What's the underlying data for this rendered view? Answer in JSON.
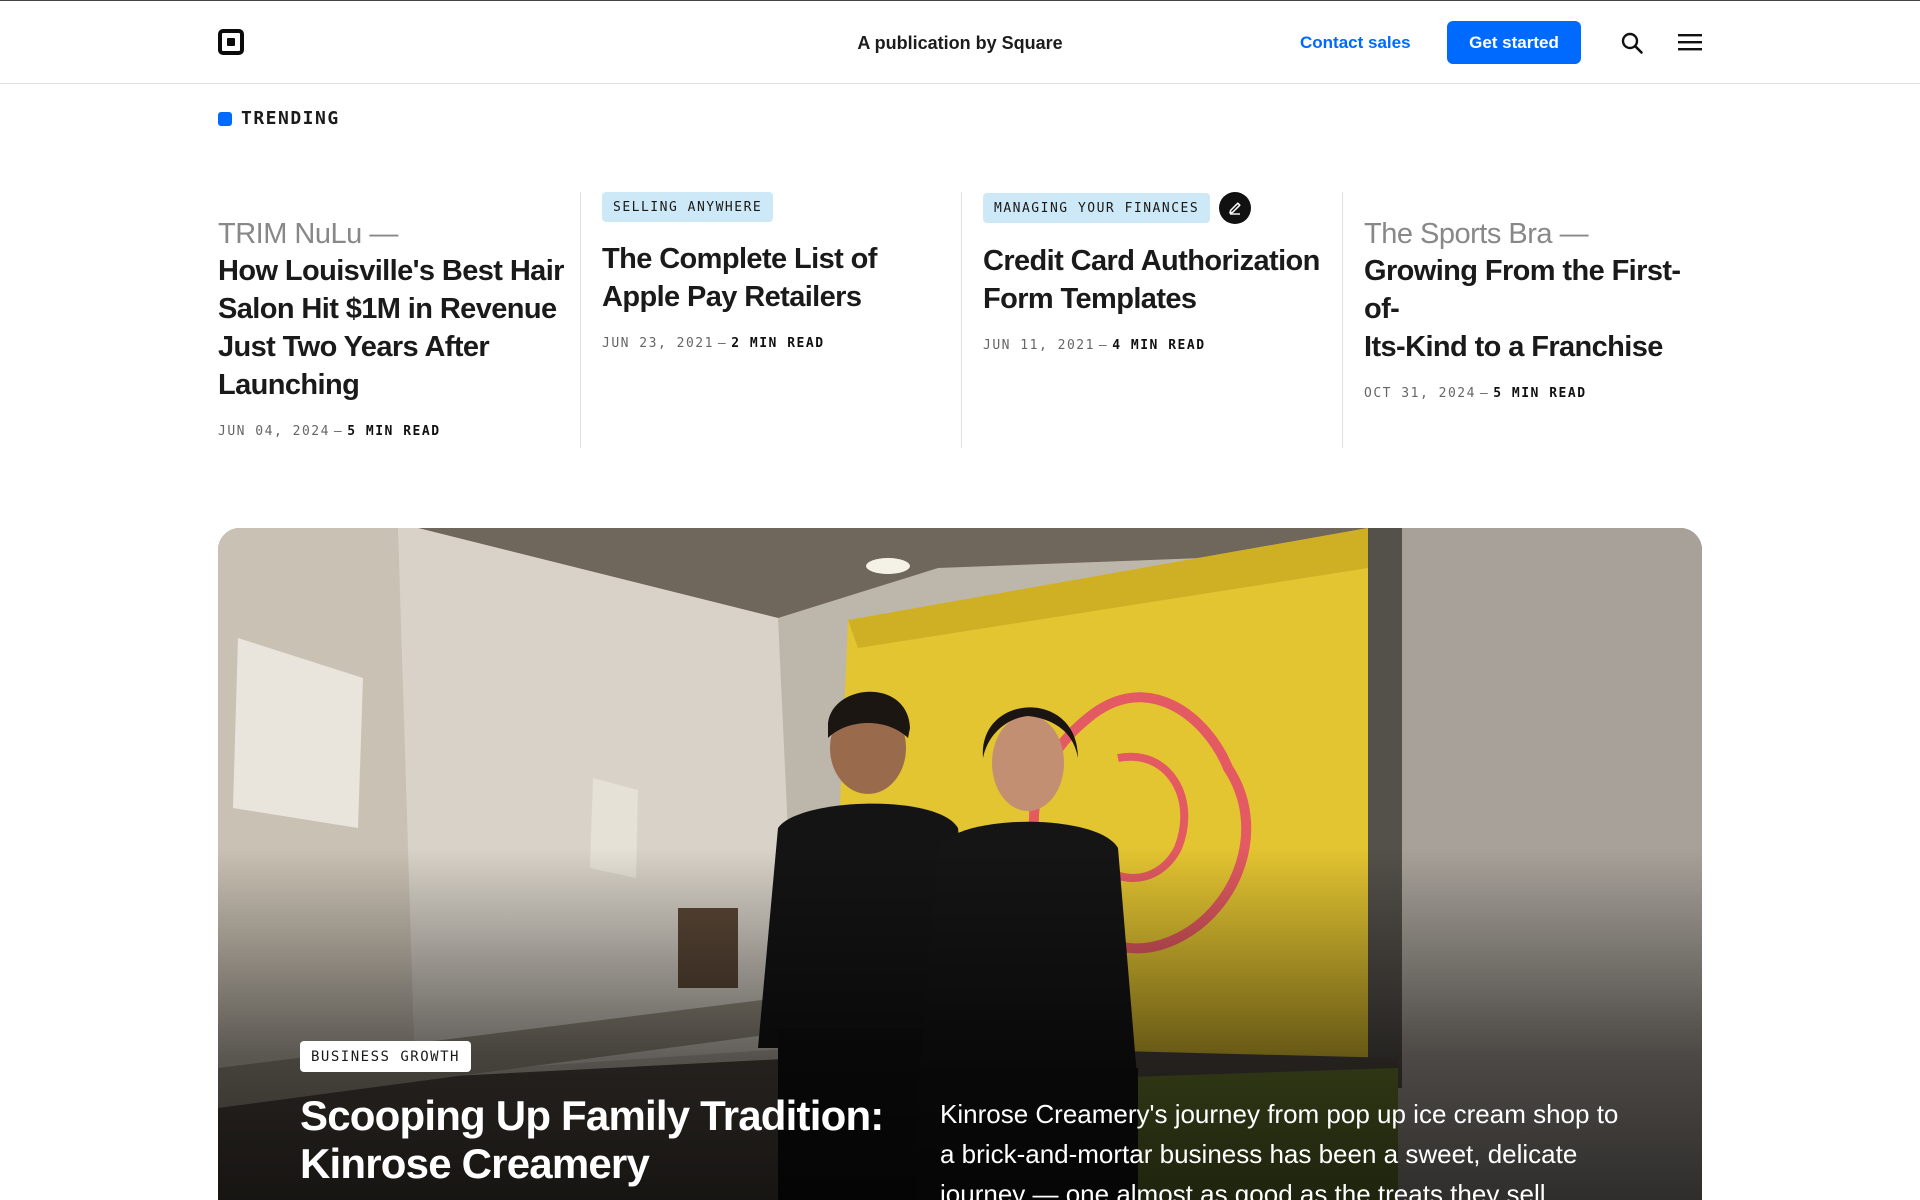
{
  "header": {
    "publication": "A publication by Square",
    "contact_sales": "Contact sales",
    "get_started": "Get started",
    "brand_color": "#006aff",
    "icons": [
      "square-logo-icon",
      "search-icon",
      "menu-icon"
    ]
  },
  "trending": {
    "label": "TRENDING",
    "cards": [
      {
        "lead": "TRIM NuLu —",
        "title_lines": [
          "How Louisville's Best Hair",
          "Salon Hit $1M in Revenue",
          "Just Two Years After",
          "Launching"
        ],
        "date": "JUN 04, 2024",
        "separator": "—",
        "read_time": "5 MIN READ"
      },
      {
        "tag": "SELLING ANYWHERE",
        "title_lines": [
          "The Complete List of",
          "Apple Pay Retailers"
        ],
        "date": "JUN 23, 2021",
        "separator": "—",
        "read_time": "2 MIN READ"
      },
      {
        "tag": "MANAGING YOUR FINANCES",
        "tag_icon": "edit-icon",
        "title_lines": [
          "Credit Card Authorization",
          "Form Templates"
        ],
        "date": "JUN 11, 2021",
        "separator": "—",
        "read_time": "4 MIN READ"
      },
      {
        "lead": "The Sports Bra —",
        "title_lines": [
          "Growing From the First-of-",
          "Its-Kind to a Franchise"
        ],
        "date": "OCT 31, 2024",
        "separator": "—",
        "read_time": "5 MIN READ"
      }
    ]
  },
  "hero": {
    "tag": "BUSINESS GROWTH",
    "title_lines": [
      "Scooping Up Family Tradition:",
      "Kinrose Creamery"
    ],
    "description": "Kinrose Creamery's journey from pop up ice cream shop to a brick-and-mortar business has been a sweet, delicate journey — one almost as good as the treats they sell."
  }
}
